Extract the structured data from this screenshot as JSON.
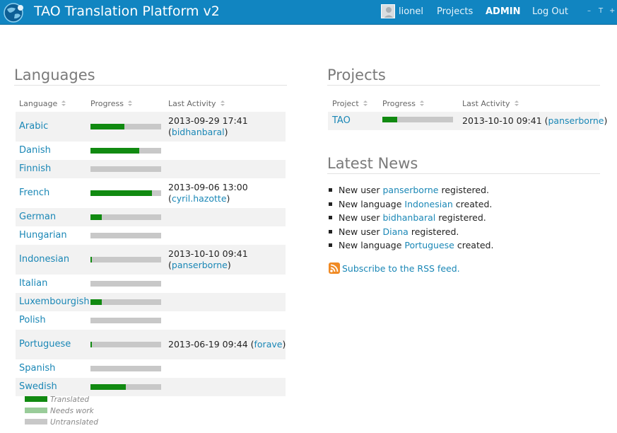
{
  "app": {
    "title": "TAO Translation Platform v2",
    "user": "lionel",
    "nav": {
      "projects": "Projects",
      "admin": "ADMIN",
      "logout": "Log Out"
    },
    "window_controls": [
      "–",
      "T",
      "+"
    ]
  },
  "languages": {
    "heading": "Languages",
    "columns": [
      "Language",
      "Progress",
      "Last Activity"
    ],
    "rows": [
      {
        "name": "Arabic",
        "translated": 0.48,
        "needs_work": 0,
        "activity": "2013-09-29 17:41",
        "user": "bidhanbaral"
      },
      {
        "name": "Danish",
        "translated": 0.69,
        "needs_work": 0,
        "activity": "",
        "user": ""
      },
      {
        "name": "Finnish",
        "translated": 0,
        "needs_work": 0,
        "activity": "",
        "user": ""
      },
      {
        "name": "French",
        "translated": 0.87,
        "needs_work": 0,
        "activity": "2013-09-06 13:00",
        "user": "cyril.hazotte"
      },
      {
        "name": "German",
        "translated": 0.16,
        "needs_work": 0,
        "activity": "",
        "user": ""
      },
      {
        "name": "Hungarian",
        "translated": 0,
        "needs_work": 0,
        "activity": "",
        "user": ""
      },
      {
        "name": "Indonesian",
        "translated": 0.02,
        "needs_work": 0,
        "activity": "2013-10-10 09:41",
        "user": "panserborne"
      },
      {
        "name": "Italian",
        "translated": 0,
        "needs_work": 0,
        "activity": "",
        "user": ""
      },
      {
        "name": "Luxembourgish",
        "translated": 0.16,
        "needs_work": 0,
        "activity": "",
        "user": ""
      },
      {
        "name": "Polish",
        "translated": 0,
        "needs_work": 0,
        "activity": "",
        "user": ""
      },
      {
        "name": "Portuguese",
        "translated": 0.02,
        "needs_work": 0,
        "activity": "2013-06-19 09:44",
        "user": "forave"
      },
      {
        "name": "Spanish",
        "translated": 0,
        "needs_work": 0,
        "activity": "",
        "user": ""
      },
      {
        "name": "Swedish",
        "translated": 0.5,
        "needs_work": 0,
        "activity": "",
        "user": ""
      }
    ]
  },
  "legend": [
    {
      "label": "Translated",
      "color": "#118a11"
    },
    {
      "label": "Needs work",
      "color": "#99cc99"
    },
    {
      "label": "Untranslated",
      "color": "#c8c8c8"
    }
  ],
  "projects": {
    "heading": "Projects",
    "columns": [
      "Project",
      "Progress",
      "Last Activity"
    ],
    "rows": [
      {
        "name": "TAO",
        "translated": 0.21,
        "activity": "2013-10-10 09:41",
        "user": "panserborne"
      }
    ]
  },
  "news": {
    "heading": "Latest News",
    "items": [
      {
        "prefix": "New user",
        "link": "panserborne",
        "suffix": "registered."
      },
      {
        "prefix": "New language",
        "link": "Indonesian",
        "suffix": "created."
      },
      {
        "prefix": "New user",
        "link": "bidhanbaral",
        "suffix": "registered."
      },
      {
        "prefix": "New user",
        "link": "Diana",
        "suffix": "registered."
      },
      {
        "prefix": "New language",
        "link": "Portuguese",
        "suffix": "created."
      }
    ],
    "rss": "Subscribe to the RSS feed."
  },
  "colors": {
    "accent": "#1185c1",
    "link": "#1a87b6",
    "translated": "#118a11",
    "untranslated": "#c8c8c8"
  }
}
